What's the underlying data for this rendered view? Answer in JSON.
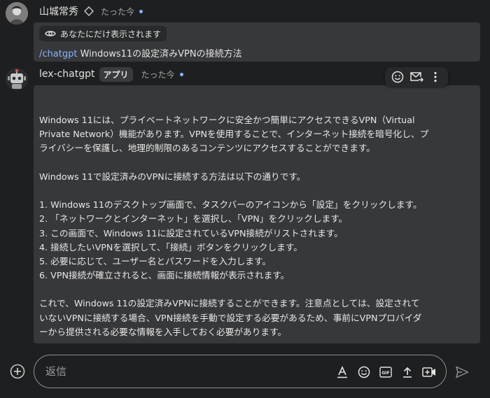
{
  "user_message": {
    "sender": "山城常秀",
    "time": "たった今",
    "private_notice": "あなたにだけ表示されます",
    "command": "/chatgpt",
    "text": "Windows11の設定済みVPNの接続方法"
  },
  "bot_message": {
    "sender": "lex-chatgpt",
    "badge": "アプリ",
    "time": "たった今",
    "lines": [
      "Windows 11には、プライベートネットワークに安全かつ簡単にアクセスできるVPN（Virtual",
      "Private Network）機能があります。VPNを使用することで、インターネット接続を暗号化し、プ",
      "ライバシーを保護し、地理的制限のあるコンテンツにアクセスすることができます。",
      "",
      "Windows 11で設定済みのVPNに接続する方法は以下の通りです。",
      "",
      "1. Windows 11のデスクトップ画面で、タスクバーのアイコンから「設定」をクリックします。",
      "2. 「ネットワークとインターネット」を選択し、「VPN」をクリックします。",
      "3. この画面で、Windows 11に設定されているVPN接続がリストされます。",
      "4. 接続したいVPNを選択して、「接続」ボタンをクリックします。",
      "5. 必要に応じて、ユーザー名とパスワードを入力します。",
      "6. VPN接続が確立されると、画面に接続情報が表示されます。",
      "",
      "これで、Windows 11の設定済みVPNに接続することができます。注意点としては、設定されて",
      "いないVPNに接続する場合、VPN接続を手動で設定する必要があるため、事前にVPNプロバイダ",
      "ーから提供される必要な情報を入手しておく必要があります。"
    ]
  },
  "composer": {
    "placeholder": "返信"
  },
  "colors": {
    "background": "#1e1f20",
    "card": "#37383a",
    "accent": "#8ab4f8",
    "text": "#e3e3e3"
  },
  "icons": {
    "user": "avatar",
    "diamond": "diamond-icon",
    "eye": "eye-icon",
    "emoji": "emoji-icon",
    "forward": "forward-mail-icon",
    "more": "more-vert-icon",
    "plus": "add-circle-icon",
    "format": "text-format-icon",
    "gif": "gif-icon",
    "upload": "upload-icon",
    "video": "video-add-icon",
    "send": "send-icon"
  }
}
